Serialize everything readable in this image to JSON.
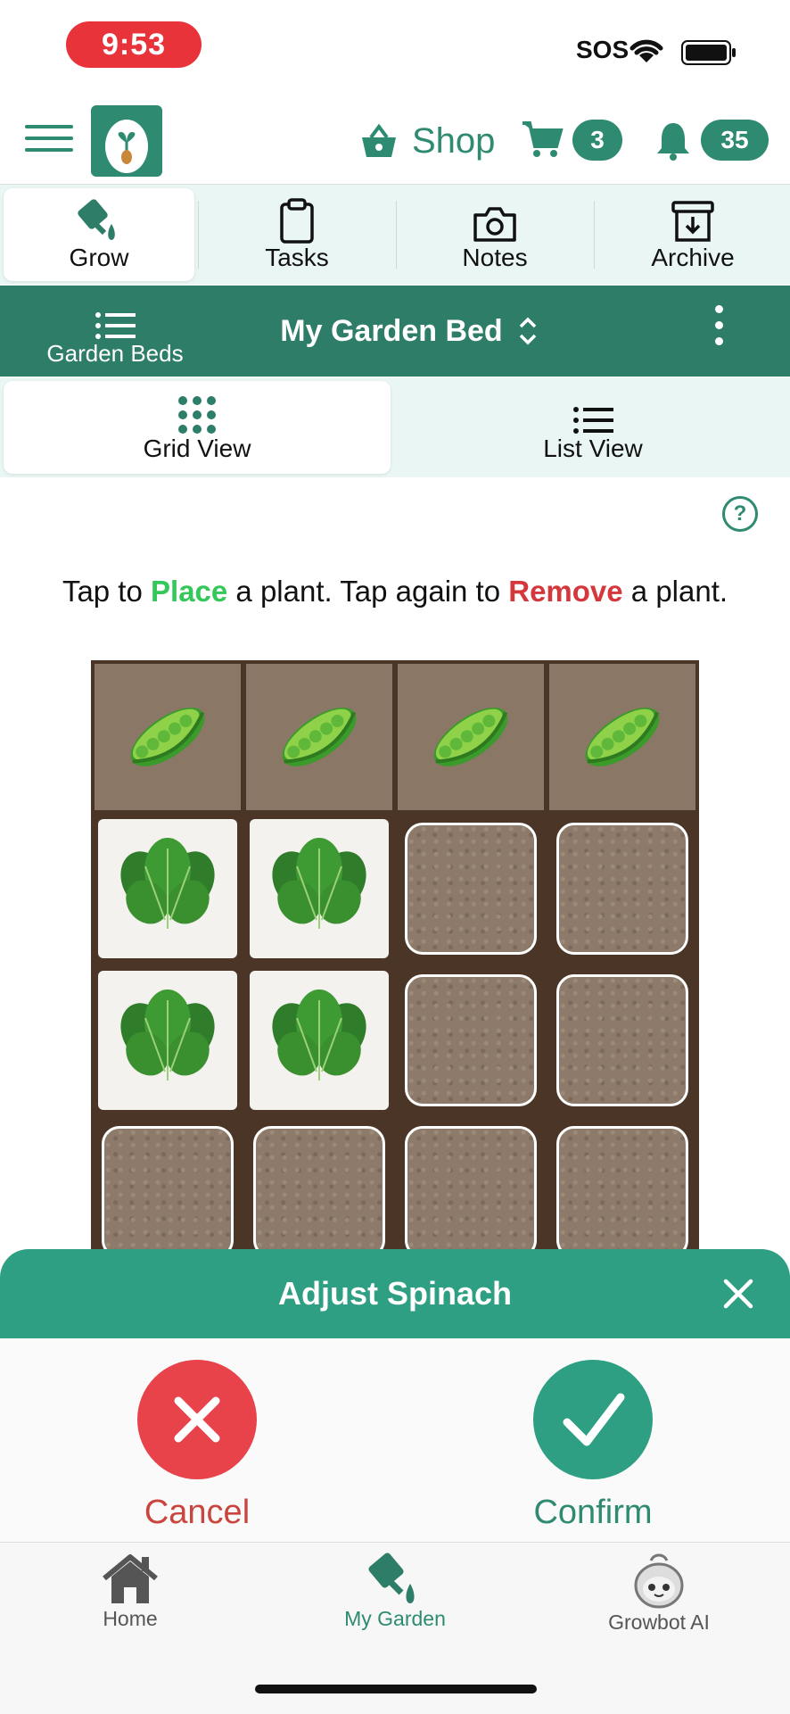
{
  "status_bar": {
    "time": "9:53",
    "sos": "SOS"
  },
  "header": {
    "shop_label": "Shop",
    "cart_count": "3",
    "notification_count": "35"
  },
  "top_tabs": [
    {
      "label": "Grow",
      "icon": "watering-can-icon",
      "selected": true
    },
    {
      "label": "Tasks",
      "icon": "clipboard-icon",
      "selected": false
    },
    {
      "label": "Notes",
      "icon": "camera-icon",
      "selected": false
    },
    {
      "label": "Archive",
      "icon": "archive-box-icon",
      "selected": false
    }
  ],
  "bed_bar": {
    "beds_label": "Garden Beds",
    "title": "My Garden Bed"
  },
  "view_tabs": [
    {
      "label": "Grid View",
      "selected": true
    },
    {
      "label": "List View",
      "selected": false
    }
  ],
  "instruction": {
    "part1": "Tap to ",
    "place": "Place",
    "part2": " a plant. Tap again to ",
    "remove": "Remove",
    "part3": " a plant."
  },
  "grid": {
    "rows": [
      [
        "pea",
        "pea",
        "pea",
        "pea"
      ],
      [
        "spinach",
        "spinach",
        "empty",
        "empty"
      ],
      [
        "spinach",
        "spinach",
        "empty",
        "empty"
      ],
      [
        "empty",
        "empty",
        "empty",
        "empty"
      ]
    ]
  },
  "sheet": {
    "title": "Adjust Spinach",
    "cancel_label": "Cancel",
    "confirm_label": "Confirm"
  },
  "bottom_nav": [
    {
      "label": "Home",
      "icon": "house-icon"
    },
    {
      "label": "My Garden",
      "icon": "watering-can-icon",
      "selected": true
    },
    {
      "label": "Growbot AI",
      "icon": "robot-icon"
    }
  ],
  "colors": {
    "brand": "#2e8b72",
    "place": "#34c759",
    "remove": "#d4373c",
    "cancel": "#e8424a",
    "confirm": "#2e9f82",
    "time_pill": "#e8333b"
  }
}
